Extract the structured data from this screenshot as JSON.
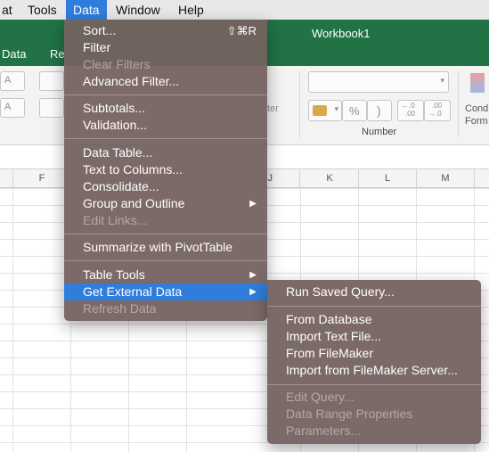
{
  "menubar": {
    "items": [
      {
        "label": "at"
      },
      {
        "label": "Tools"
      },
      {
        "label": "Data"
      },
      {
        "label": "Window"
      },
      {
        "label": "Help"
      }
    ]
  },
  "titlebar": {
    "workbook": "Workbook1",
    "tabs": [
      "Data",
      "Re"
    ]
  },
  "ribbon": {
    "font_size_partial": "A",
    "filter_partial": "ter",
    "percent": "%",
    "number_group_label": "Number",
    "conditional_partial_1": "Cond",
    "conditional_partial_2": "Form",
    "inc_decimal_top": "←.0",
    "inc_decimal_bottom": ".00",
    "dec_decimal_top": ".00",
    "dec_decimal_bottom": "→.0"
  },
  "columns": [
    "F",
    "",
    "",
    "J",
    "K",
    "L",
    "M"
  ],
  "data_menu": {
    "items": [
      {
        "label": "Sort...",
        "shortcut": "⇧⌘R"
      },
      {
        "label": "Filter"
      },
      {
        "label": "Clear Filters",
        "disabled": true
      },
      {
        "label": "Advanced Filter..."
      },
      {
        "label": "Subtotals..."
      },
      {
        "label": "Validation..."
      },
      {
        "label": "Data Table..."
      },
      {
        "label": "Text to Columns..."
      },
      {
        "label": "Consolidate..."
      },
      {
        "label": "Group and Outline",
        "submenu": true
      },
      {
        "label": "Edit Links...",
        "disabled": true
      },
      {
        "label": "Summarize with PivotTable"
      },
      {
        "label": "Table Tools",
        "submenu": true
      },
      {
        "label": "Get External Data",
        "submenu": true,
        "highlighted": true
      },
      {
        "label": "Refresh Data",
        "disabled": true
      }
    ],
    "submenu_arrow": "▶"
  },
  "external_submenu": {
    "items": [
      {
        "label": "Run Saved Query..."
      },
      {
        "label": "From Database"
      },
      {
        "label": "Import Text File..."
      },
      {
        "label": "From FileMaker"
      },
      {
        "label": "Import from FileMaker Server..."
      },
      {
        "label": "Edit Query...",
        "disabled": true
      },
      {
        "label": "Data Range Properties",
        "disabled": true
      },
      {
        "label": "Parameters...",
        "disabled": true
      }
    ]
  },
  "colors": {
    "menu_bg": "#74625f",
    "highlight": "#2f7ddc",
    "excel_green": "#217346"
  }
}
